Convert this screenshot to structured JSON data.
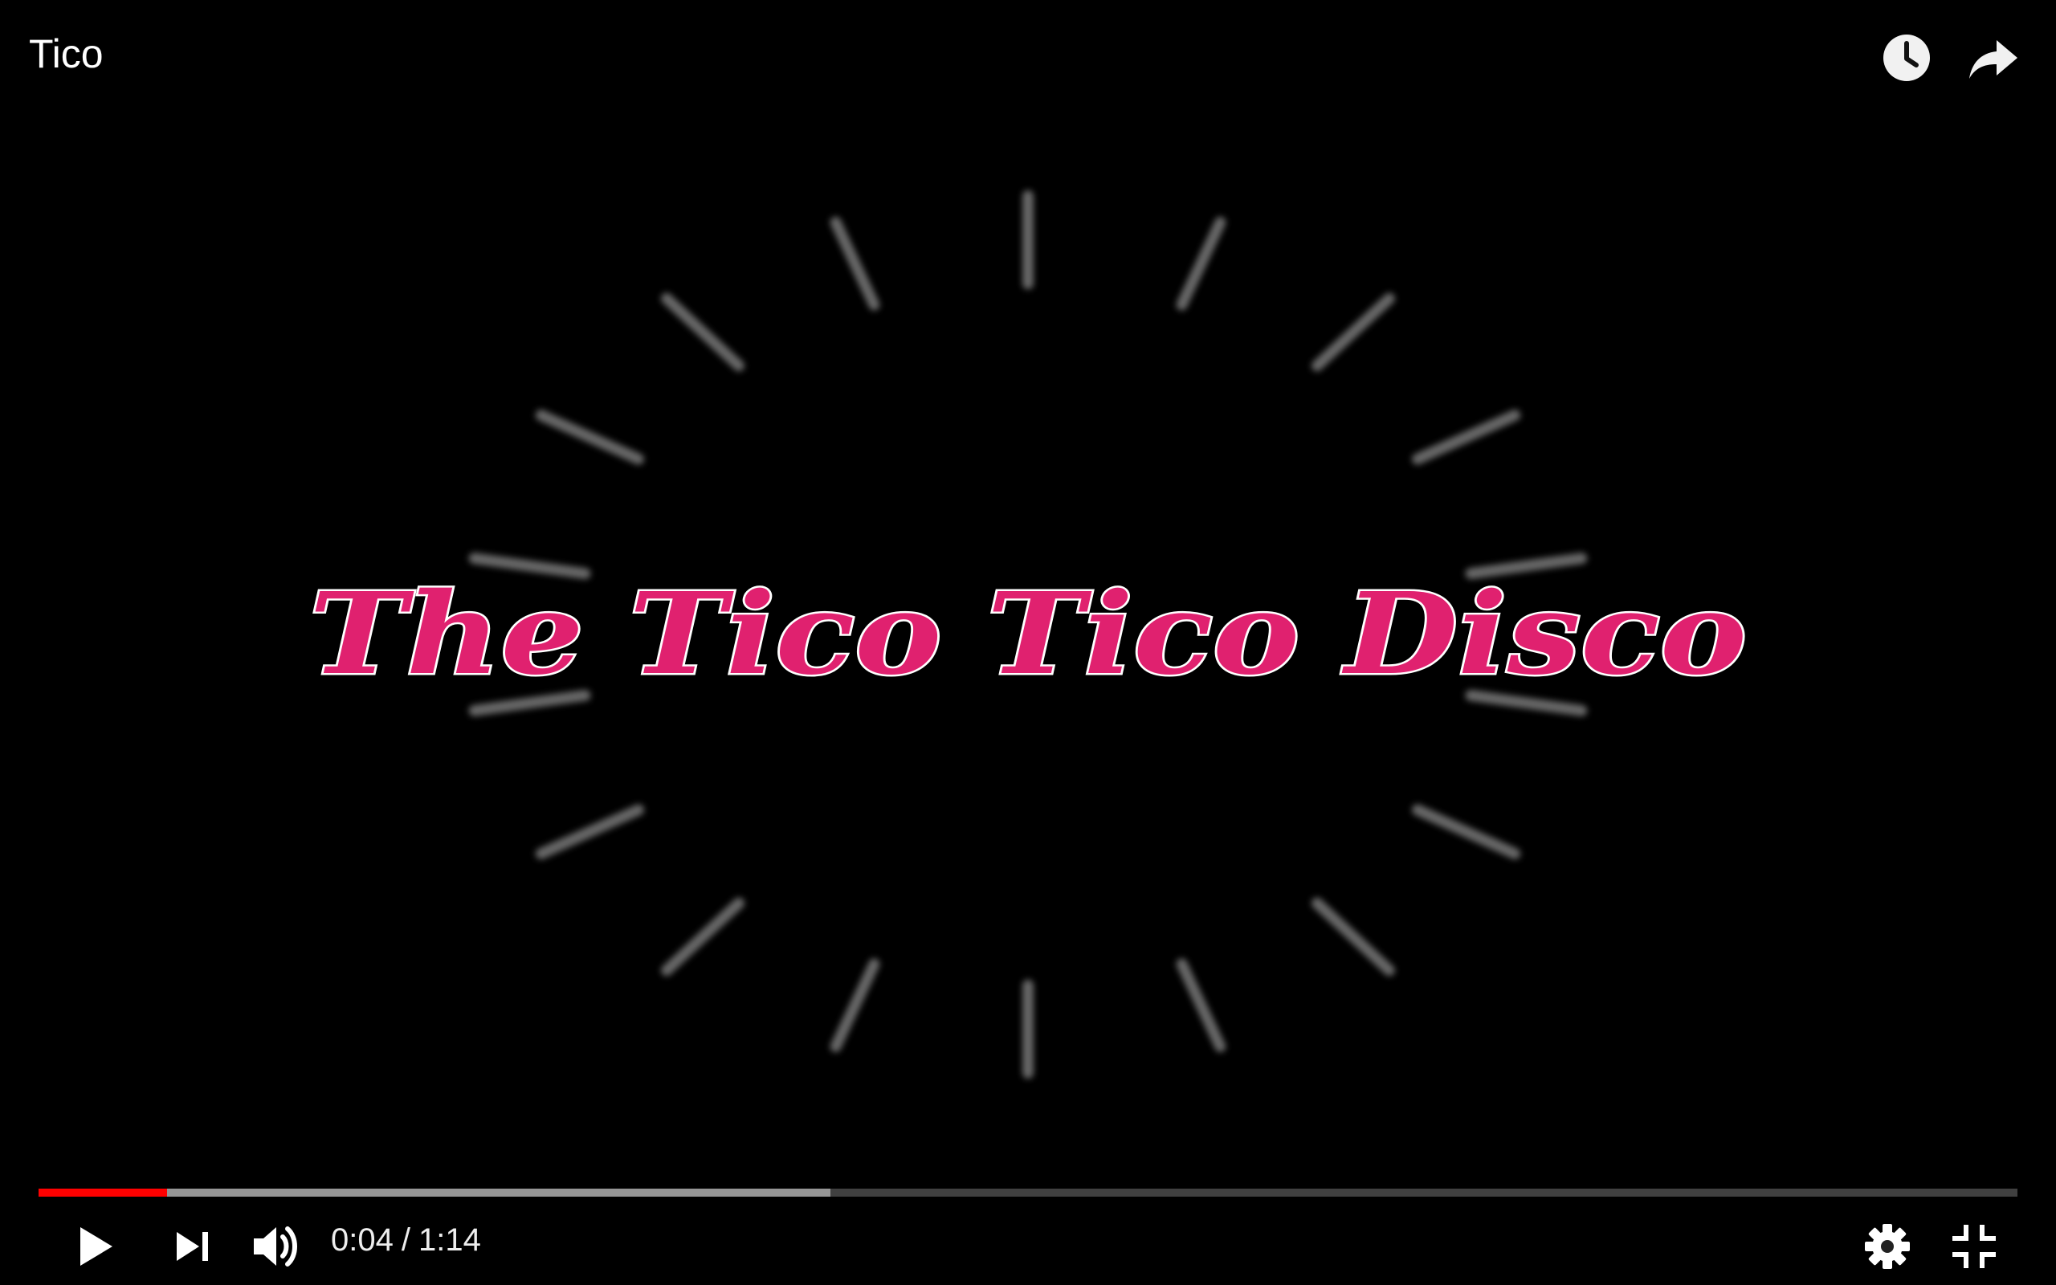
{
  "video": {
    "title": "Tico",
    "frame_caption": "The Tico Tico Disco",
    "caption_color": "#e0216f"
  },
  "top_actions": {
    "watch_later_icon": "clock-icon",
    "share_icon": "share-arrow-icon"
  },
  "player": {
    "current_time": "0:04",
    "time_separator": "/",
    "duration": "1:14",
    "progress_played_fraction": 0.065,
    "progress_buffered_fraction": 0.4,
    "accent_color": "#ff0000",
    "icons": {
      "play": "play-icon",
      "next": "skip-next-icon",
      "volume": "volume-icon",
      "settings": "gear-icon",
      "exit_fullscreen": "exit-fullscreen-icon"
    }
  }
}
